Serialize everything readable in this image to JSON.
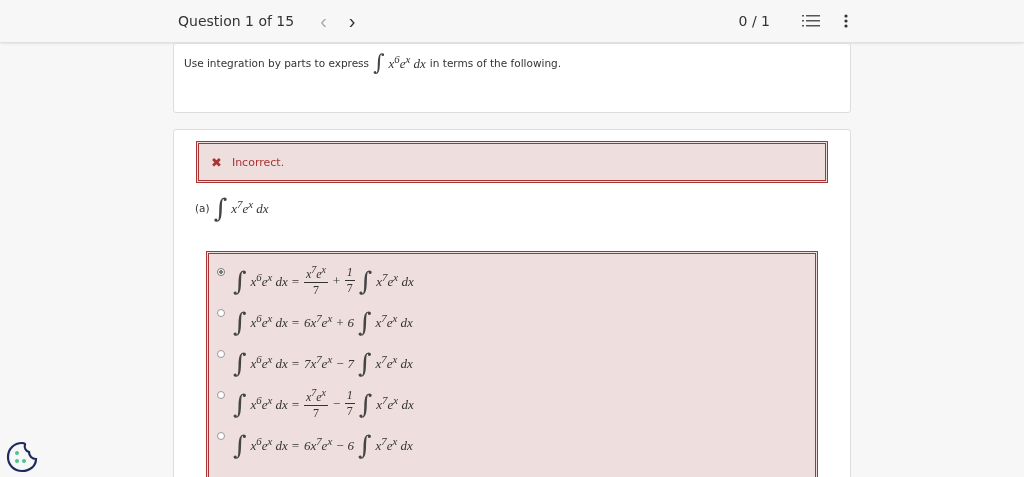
{
  "header": {
    "progress": "Question 1 of 15",
    "prev": {
      "symbol": "‹",
      "disabled": true
    },
    "next": {
      "symbol": "›",
      "disabled": false
    },
    "score": "0 / 1"
  },
  "question": {
    "parts": [
      {
        "kind": "text",
        "text": "Use integration by parts to express"
      },
      {
        "kind": "integral",
        "text": "∫"
      },
      {
        "kind": "math",
        "text": "x$^{6}$e$^{x}$ dx"
      },
      {
        "kind": "text",
        "text": "in terms of the following."
      }
    ]
  },
  "feedback": {
    "correct": false,
    "symbol": "✖",
    "text": "Incorrect."
  },
  "part": {
    "label": "(a)",
    "parts": [
      {
        "kind": "integral",
        "text": "∫"
      },
      {
        "kind": "math",
        "text": "x$^{7}$e$^{x}$ dx"
      }
    ]
  },
  "options": [
    {
      "selected": true,
      "parts": [
        {
          "kind": "integral",
          "text": "∫"
        },
        {
          "kind": "math",
          "text": "x$^{6}$e$^{x}$ dx ="
        },
        {
          "kind": "frac",
          "num": "x$^{7}$e$^{x}$",
          "den": "7"
        },
        {
          "kind": "math",
          "text": "+"
        },
        {
          "kind": "frac",
          "num": "1",
          "den": "7"
        },
        {
          "kind": "integral",
          "text": "∫"
        },
        {
          "kind": "math",
          "text": "x$^{7}$e$^{x}$ dx"
        }
      ]
    },
    {
      "selected": false,
      "parts": [
        {
          "kind": "integral",
          "text": "∫"
        },
        {
          "kind": "math",
          "text": "x$^{6}$e$^{x}$ dx ="
        },
        {
          "kind": "math",
          "text": "6x$^{7}$e$^{x}$ + 6"
        },
        {
          "kind": "integral",
          "text": "∫"
        },
        {
          "kind": "math",
          "text": "x$^{7}$e$^{x}$ dx"
        }
      ]
    },
    {
      "selected": false,
      "parts": [
        {
          "kind": "integral",
          "text": "∫"
        },
        {
          "kind": "math",
          "text": "x$^{6}$e$^{x}$ dx ="
        },
        {
          "kind": "math",
          "text": "7x$^{7}$e$^{x}$ − 7"
        },
        {
          "kind": "integral",
          "text": "∫"
        },
        {
          "kind": "math",
          "text": "x$^{7}$e$^{x}$ dx"
        }
      ]
    },
    {
      "selected": false,
      "parts": [
        {
          "kind": "integral",
          "text": "∫"
        },
        {
          "kind": "math",
          "text": "x$^{6}$e$^{x}$ dx ="
        },
        {
          "kind": "frac",
          "num": "x$^{7}$e$^{x}$",
          "den": "7"
        },
        {
          "kind": "math",
          "text": "−"
        },
        {
          "kind": "frac",
          "num": "1",
          "den": "7"
        },
        {
          "kind": "integral",
          "text": "∫"
        },
        {
          "kind": "math",
          "text": "x$^{7}$e$^{x}$ dx"
        }
      ]
    },
    {
      "selected": false,
      "parts": [
        {
          "kind": "integral",
          "text": "∫"
        },
        {
          "kind": "math",
          "text": "x$^{6}$e$^{x}$ dx ="
        },
        {
          "kind": "math",
          "text": "6x$^{7}$e$^{x}$ − 6"
        },
        {
          "kind": "integral",
          "text": "∫"
        },
        {
          "kind": "math",
          "text": "x$^{7}$e$^{x}$ dx"
        }
      ]
    }
  ]
}
